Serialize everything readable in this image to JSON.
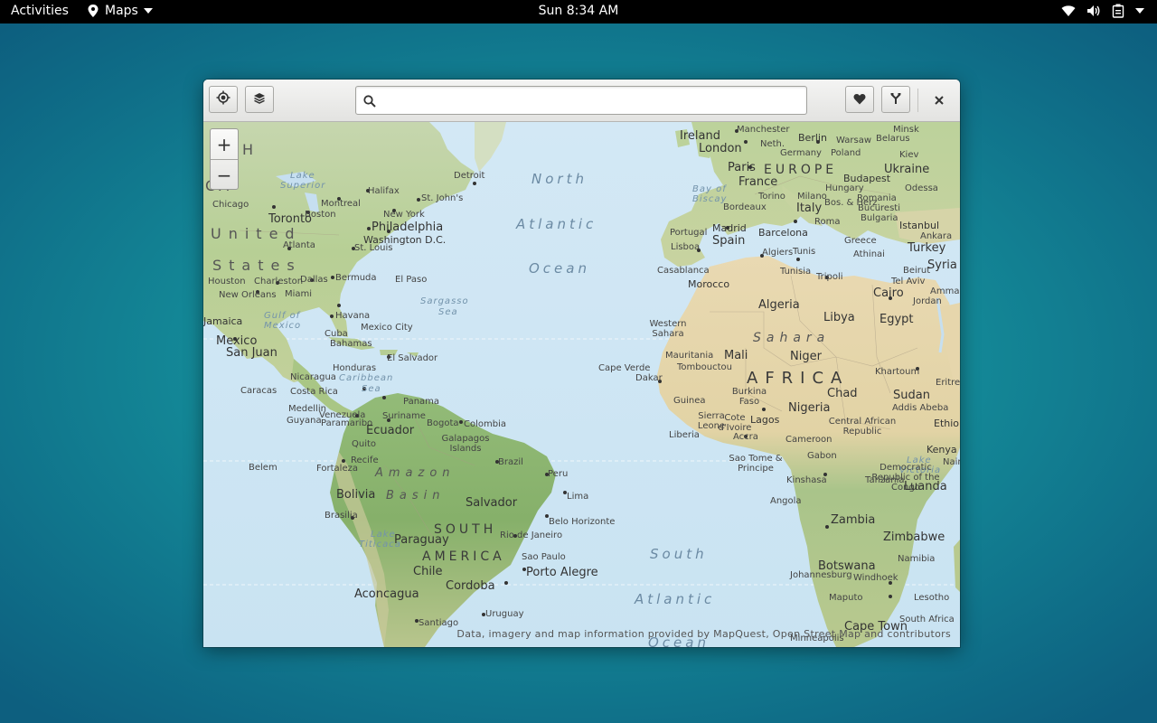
{
  "topbar": {
    "activities": "Activities",
    "app_name": "Maps",
    "clock": "Sun  8:34 AM"
  },
  "window": {
    "search": {
      "value": "",
      "placeholder": ""
    },
    "zoom_in": "+",
    "zoom_out": "−",
    "attribution": "Data, imagery and map information provided by MapQuest, Open Street Map and contributors"
  },
  "map": {
    "continent_labels": [
      "EUROPE",
      "AFRICA",
      "SOUTH",
      "AMERICA",
      "United",
      "States",
      "CA",
      "H",
      "Sahara",
      "Amazon",
      "Basin"
    ],
    "ocean_labels": [
      "North",
      "Atlantic",
      "Ocean",
      "South",
      "Atlantic",
      "Ocean"
    ],
    "sea_labels": [
      "Sargasso",
      "Sea",
      "Gulf of",
      "Mexico",
      "Caribbean",
      "Sea",
      "Bay of",
      "Biscay",
      "Lake",
      "Superior",
      "Lake",
      "Victoria",
      "Lake",
      "Titicaca"
    ],
    "places": [
      "Ireland",
      "London",
      "Manchester",
      "Neth.",
      "Berlin",
      "Warsaw",
      "Belarus",
      "Minsk",
      "Germany",
      "Poland",
      "Paris",
      "Kiev",
      "Ukraine",
      "France",
      "Budapest",
      "Hungary",
      "Odessa",
      "Bordeaux",
      "Torino",
      "Milano",
      "Romania",
      "Italy",
      "Bos. & Herz.",
      "Bucuresti",
      "Bulgaria",
      "Roma",
      "Istanbul",
      "Madrid",
      "Spain",
      "Portugal",
      "Lisboa",
      "Barcelona",
      "Greece",
      "Turkey",
      "Ankara",
      "Athinai",
      "Algiers",
      "Tunis",
      "Casablanca",
      "Tunisia",
      "Tripoli",
      "Beirut",
      "Syria",
      "Tel Aviv",
      "Amman",
      "Jordan",
      "Morocco",
      "Algeria",
      "Cairo",
      "Libya",
      "Egypt",
      "Western Sahara",
      "Mauritania",
      "Mali",
      "Niger",
      "Tombouctou",
      "Cape Verde",
      "Dakar",
      "Khartoum",
      "Sudan",
      "Chad",
      "Guinea",
      "Burkina Faso",
      "Nigeria",
      "Addis Abeba",
      "Eritrea",
      "Ethiopia",
      "Sierra Leone",
      "Cote d'Ivoire",
      "Lagos",
      "Central African Republic",
      "Liberia",
      "Accra",
      "Cameroon",
      "Kenya",
      "Nairobi",
      "Sao Tome & Principe",
      "Gabon",
      "Democratic Republic of the Congo",
      "Kinshasa",
      "Tanzania",
      "Luanda",
      "Angola",
      "Zambia",
      "Zimbabwe",
      "Namibia",
      "Botswana",
      "Windhoek",
      "Johannesburg",
      "Maputo",
      "Lesotho",
      "South Africa",
      "Cape Town",
      "Minneapolis",
      "Chicago",
      "Toronto",
      "Montreal",
      "Halifax",
      "St. John's",
      "Detroit",
      "Boston",
      "New York",
      "Philadelphia",
      "Washington D.C.",
      "St. Louis",
      "Atlanta",
      "Dallas",
      "Charleston",
      "Bermuda",
      "El Paso",
      "Houston",
      "New Orleans",
      "Miami",
      "Havana",
      "Cuba",
      "Bahamas",
      "Mexico City",
      "Mexico",
      "Jamaica",
      "San Juan",
      "Honduras",
      "El Salvador",
      "Nicaragua",
      "Caracas",
      "Costa Rica",
      "Panama",
      "Medellin",
      "Venezuela",
      "Guyana",
      "Paramaribo",
      "Suriname",
      "Bogota",
      "Colombia",
      "Galapagos Islands",
      "Ecuador",
      "Quito",
      "Belem",
      "Fortaleza",
      "Recife",
      "Brazil",
      "Peru",
      "Lima",
      "Salvador",
      "Bolivia",
      "Brasilia",
      "Belo Horizonte",
      "Paraguay",
      "Rio de Janeiro",
      "Sao Paulo",
      "Chile",
      "Porto Alegre",
      "Cordoba",
      "Aconcagua",
      "Uruguay",
      "Santiago"
    ]
  }
}
